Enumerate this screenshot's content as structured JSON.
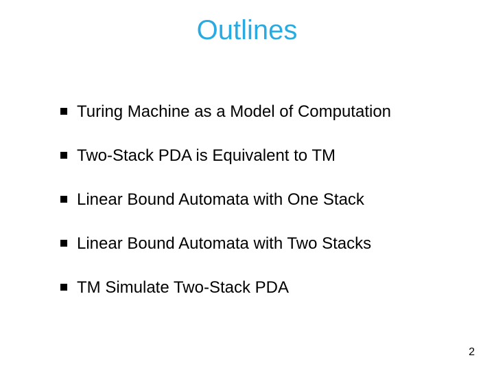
{
  "title": "Outlines",
  "bullets": [
    "Turing Machine as a Model of Computation",
    "Two-Stack PDA is Equivalent to TM",
    "Linear Bound Automata with One Stack",
    "Linear Bound Automata with Two Stacks",
    "TM Simulate Two-Stack PDA"
  ],
  "page_number": "2"
}
